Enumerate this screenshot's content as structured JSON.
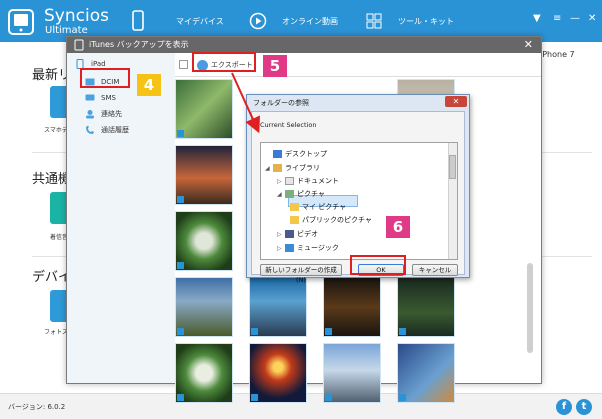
{
  "app": {
    "name": "Syncios",
    "edition": "Ultimate",
    "nav": [
      "マイデバイス",
      "オンライン動画",
      "ツール・キット"
    ],
    "version_text": "バージョン: 6.0.2",
    "device_label": "iPhone 7",
    "accent_color": "#2a93d6"
  },
  "background": {
    "sections": [
      "最新リ",
      "共通機",
      "デバイス"
    ],
    "tiles": [
      "スマホデ",
      "着信音",
      "フォトスト"
    ]
  },
  "dialog": {
    "title": "iTunes バックアップを表示",
    "sidebar": {
      "device": "iPad",
      "items": [
        "DCIM",
        "SMS",
        "連絡先",
        "通話履歴"
      ]
    },
    "toolbar": {
      "export_label": "エクスポート"
    }
  },
  "folder_dialog": {
    "title": "フォルダーの参照",
    "current_selection_label": "Current Selection",
    "tree": [
      "デスクトップ",
      "ライブラリ",
      "ドキュメント",
      "ピクチャ",
      "マイ ピクチャ",
      "パブリックのピクチャ",
      "ビデオ",
      "ミュージック"
    ],
    "buttons": {
      "new_folder": "新しいフォルダーの作成(N)",
      "ok": "OK",
      "cancel": "キャンセル"
    }
  },
  "steps": [
    "4",
    "5",
    "6"
  ],
  "social": [
    "f",
    "t"
  ]
}
